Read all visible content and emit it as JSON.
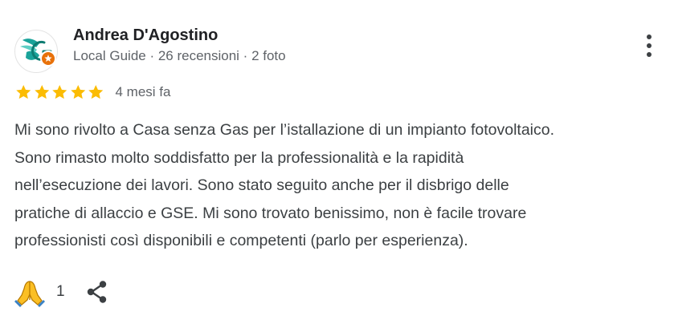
{
  "colors": {
    "star": "#fbbc04",
    "meta_text": "#5f6368",
    "body_text": "#3c4043",
    "avatar_accent": "#1aa39a",
    "badge": "#e8710a"
  },
  "review": {
    "author": {
      "name": "Andrea D'Agostino",
      "meta": "Local Guide · 26 recensioni · 2 foto",
      "avatar_icon": "local-guide-avatar-icon"
    },
    "rating": 5,
    "rating_max": 5,
    "date": "4 mesi fa",
    "text_lines": [
      "Mi sono rivolto a Casa senza Gas per l’istallazione di un impianto fotovoltaico.",
      "Sono rimasto molto soddisfatto per la professionalità e la rapidità",
      "nell’esecuzione dei lavori. Sono stato seguito anche per il disbrigo delle",
      "pratiche di allaccio e GSE. Mi sono trovato benissimo, non è facile trovare",
      "professionisti così disponibili e competenti (parlo per esperienza)."
    ],
    "reaction": {
      "icon": "folded-hands-icon",
      "count": "1"
    },
    "share_icon": "share-icon",
    "more_icon": "more-vert-icon"
  }
}
